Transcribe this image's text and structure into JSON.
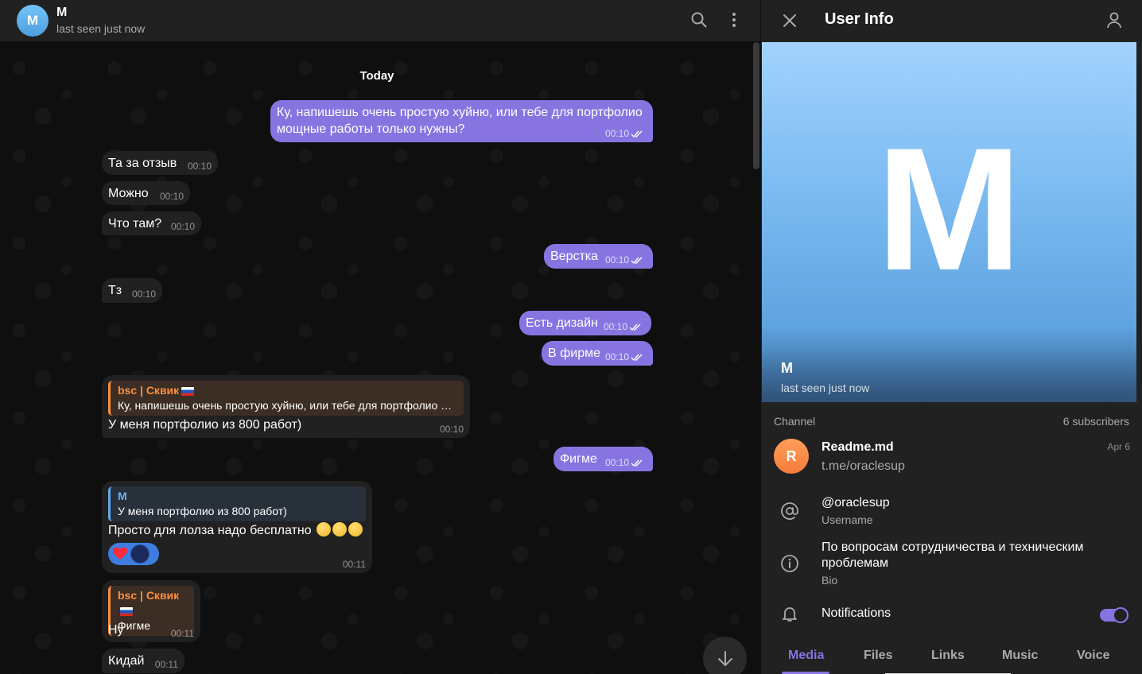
{
  "header": {
    "avatar_letter": "M",
    "name": "M",
    "status": "last seen just now"
  },
  "chat": {
    "date_label": "Today",
    "messages": [
      {
        "dir": "out",
        "lines": [
          "Ку, напишешь очень простую хуйню, или тебе для портфолио",
          "мощные работы только нужны?"
        ],
        "time": "00:10",
        "read": true
      },
      {
        "dir": "in",
        "text": "Та за отзыв",
        "time": "00:10"
      },
      {
        "dir": "in",
        "text": "Можно",
        "time": "00:10"
      },
      {
        "dir": "in",
        "text": "Что там?",
        "time": "00:10"
      },
      {
        "dir": "out",
        "text": "Верстка",
        "time": "00:10",
        "read": true
      },
      {
        "dir": "in",
        "text": "Тз",
        "time": "00:10"
      },
      {
        "dir": "out",
        "text": "Есть дизайн",
        "time": "00:10",
        "read": true
      },
      {
        "dir": "out",
        "text": "В фирме",
        "time": "00:10",
        "read": true
      },
      {
        "dir": "in",
        "reply_author": "bsc | Сквик",
        "reply_text": "Ку, напишешь очень простую хуйню, или тебе для портфолио м...",
        "text": "У меня портфолио из 800 работ)",
        "time": "00:10"
      },
      {
        "dir": "out",
        "text": "Фигме",
        "time": "00:10",
        "read": true
      },
      {
        "dir": "in",
        "reply_author": "M",
        "reply_text": "У меня портфолио из 800 работ)",
        "text": "Просто для лолза надо бесплатно",
        "time": "00:11"
      },
      {
        "dir": "in",
        "reply_author": "bsc | Сквик",
        "reply_text": "Фигме",
        "text": "Ну",
        "time": "00:11"
      },
      {
        "dir": "in",
        "text": "Кидай",
        "time": "00:11"
      }
    ]
  },
  "panel": {
    "title": "User Info",
    "photo_letter": "M",
    "name": "M",
    "status": "last seen just now",
    "channel_label": "Channel",
    "subscribers": "6 subscribers",
    "channel": {
      "avatar_letter": "R",
      "title": "Readme.md",
      "link": "t.me/oraclesup",
      "date": "Apr 6"
    },
    "username": {
      "value": "@oraclesup",
      "label": "Username"
    },
    "bio": {
      "lines": [
        "По вопросам сотрудничества и техническим",
        "проблемам"
      ],
      "label": "Bio"
    },
    "notifications": {
      "label": "Notifications",
      "enabled": true
    },
    "tabs": [
      "Media",
      "Files",
      "Links",
      "Music",
      "Voice"
    ],
    "active_tab": "Media"
  },
  "colors": {
    "accent": "#8774e1",
    "incoming_bubble": "#212121",
    "background": "#0f0f0f",
    "reply_orange": "#ff8e3c",
    "reply_blue": "#6cb2f5"
  }
}
